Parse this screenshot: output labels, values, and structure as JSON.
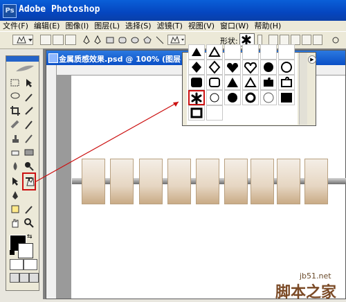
{
  "app": {
    "title": "Adobe Photoshop",
    "logo_text": "Ps"
  },
  "menu": [
    "文件(F)",
    "编辑(E)",
    "图像(I)",
    "图层(L)",
    "选择(S)",
    "滤镜(T)",
    "视图(V)",
    "窗口(W)",
    "帮助(H)"
  ],
  "options_bar": {
    "shape_label": "形状:",
    "selected_shape_icon": "asterisk-star"
  },
  "document": {
    "title": "金属质感效果.psd @ 100% (图层"
  },
  "shape_picker": {
    "rows": [
      [
        "triangle-up",
        "triangle-up-outline",
        "heart",
        "heart-outline",
        "flower",
        "star-burst"
      ],
      [
        "diamond",
        "diamond-outline",
        "heart-filled",
        "heart-outline-2",
        "flower",
        "flower-outline"
      ],
      [
        "square-rounded",
        "square-rounded-outline",
        "triangle",
        "triangle-outline",
        "puzzle",
        "puzzle-outline"
      ],
      [
        "asterisk",
        "asterisk-outline",
        "circle",
        "ring",
        "circle-outline",
        "square"
      ],
      [
        "square-frame",
        "square-outline"
      ]
    ],
    "selected": "asterisk"
  },
  "watermark": {
    "url": "jb51.net",
    "site": "脚本之家"
  },
  "colors": {
    "highlight": "#cc1111",
    "title_bar": "#0a5fd8"
  }
}
